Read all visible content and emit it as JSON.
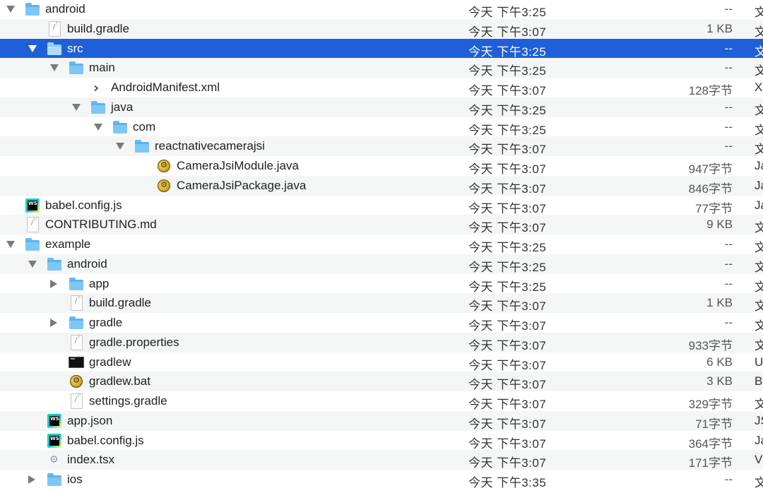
{
  "rows": [
    {
      "name": "android",
      "date": "今天 下午3:25",
      "size": "--",
      "kind": "文",
      "icon": "folder-icon",
      "disclosure": "open"
    },
    {
      "name": "build.gradle",
      "date": "今天 下午3:07",
      "size": "1 KB",
      "kind": "文",
      "icon": "document-icon",
      "disclosure": "none"
    },
    {
      "name": "src",
      "date": "今天 下午3:25",
      "size": "--",
      "kind": "文",
      "icon": "folder-icon",
      "disclosure": "open",
      "selected": true
    },
    {
      "name": "main",
      "date": "今天 下午3:25",
      "size": "--",
      "kind": "文",
      "icon": "folder-icon",
      "disclosure": "open"
    },
    {
      "name": "AndroidManifest.xml",
      "date": "今天 下午3:07",
      "size": "128字节",
      "kind": "X",
      "icon": "xml-chevron-icon",
      "disclosure": "none"
    },
    {
      "name": "java",
      "date": "今天 下午3:25",
      "size": "--",
      "kind": "文",
      "icon": "folder-icon",
      "disclosure": "open"
    },
    {
      "name": "com",
      "date": "今天 下午3:25",
      "size": "--",
      "kind": "文",
      "icon": "folder-icon",
      "disclosure": "open"
    },
    {
      "name": "reactnativecamerajsi",
      "date": "今天 下午3:07",
      "size": "--",
      "kind": "文",
      "icon": "folder-icon",
      "disclosure": "open"
    },
    {
      "name": "CameraJsiModule.java",
      "date": "今天 下午3:07",
      "size": "947字节",
      "kind": "Ja",
      "icon": "java-file-icon",
      "disclosure": "none"
    },
    {
      "name": "CameraJsiPackage.java",
      "date": "今天 下午3:07",
      "size": "846字节",
      "kind": "Ja",
      "icon": "java-file-icon",
      "disclosure": "none"
    },
    {
      "name": "babel.config.js",
      "date": "今天 下午3:07",
      "size": "77字节",
      "kind": "Ja",
      "icon": "webstorm-icon",
      "disclosure": "none"
    },
    {
      "name": "CONTRIBUTING.md",
      "date": "今天 下午3:07",
      "size": "9 KB",
      "kind": "文",
      "icon": "document-icon",
      "disclosure": "none"
    },
    {
      "name": "example",
      "date": "今天 下午3:25",
      "size": "--",
      "kind": "文",
      "icon": "folder-icon",
      "disclosure": "open"
    },
    {
      "name": "android",
      "date": "今天 下午3:25",
      "size": "--",
      "kind": "文",
      "icon": "folder-icon",
      "disclosure": "open"
    },
    {
      "name": "app",
      "date": "今天 下午3:25",
      "size": "--",
      "kind": "文",
      "icon": "folder-icon",
      "disclosure": "closed"
    },
    {
      "name": "build.gradle",
      "date": "今天 下午3:07",
      "size": "1 KB",
      "kind": "文",
      "icon": "document-icon",
      "disclosure": "none"
    },
    {
      "name": "gradle",
      "date": "今天 下午3:07",
      "size": "--",
      "kind": "文",
      "icon": "folder-icon",
      "disclosure": "closed"
    },
    {
      "name": "gradle.properties",
      "date": "今天 下午3:07",
      "size": "933字节",
      "kind": "文",
      "icon": "document-icon",
      "disclosure": "none"
    },
    {
      "name": "gradlew",
      "date": "今天 下午3:07",
      "size": "6 KB",
      "kind": "U",
      "icon": "terminal-icon",
      "disclosure": "none"
    },
    {
      "name": "gradlew.bat",
      "date": "今天 下午3:07",
      "size": "3 KB",
      "kind": "B",
      "icon": "script-file-icon",
      "disclosure": "none"
    },
    {
      "name": "settings.gradle",
      "date": "今天 下午3:07",
      "size": "329字节",
      "kind": "文",
      "icon": "document-icon",
      "disclosure": "none"
    },
    {
      "name": "app.json",
      "date": "今天 下午3:07",
      "size": "71字节",
      "kind": "JS",
      "icon": "webstorm-icon",
      "disclosure": "none"
    },
    {
      "name": "babel.config.js",
      "date": "今天 下午3:07",
      "size": "364字节",
      "kind": "Ja",
      "icon": "webstorm-icon",
      "disclosure": "none"
    },
    {
      "name": "index.tsx",
      "date": "今天 下午3:07",
      "size": "171字节",
      "kind": "V",
      "icon": "gear-icon",
      "disclosure": "none"
    },
    {
      "name": "ios",
      "date": "今天 下午3:35",
      "size": "--",
      "kind": "文",
      "icon": "folder-icon",
      "disclosure": "closed"
    }
  ],
  "colors": {
    "selection": "#1f5fd8",
    "stripe": "#f4f5f5",
    "folder": "#7cc7f6"
  }
}
